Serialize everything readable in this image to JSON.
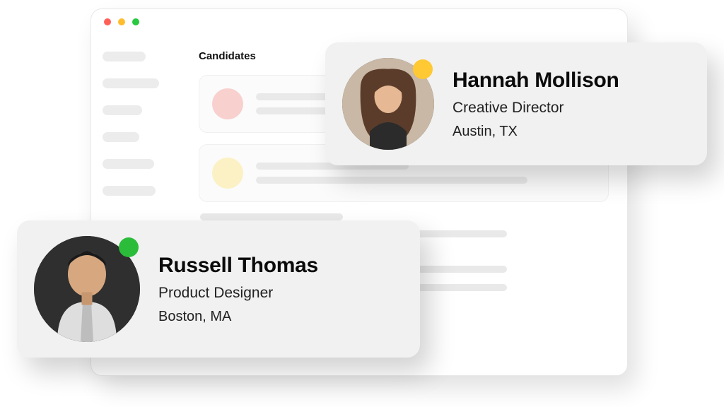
{
  "window": {
    "section_title": "Candidates"
  },
  "candidates": [
    {
      "name": "Hannah Mollison",
      "role": "Creative Director",
      "location": "Austin, TX",
      "status_color": "#ffc933"
    },
    {
      "name": "Russell Thomas",
      "role": "Product Designer",
      "location": "Boston, MA",
      "status_color": "#2bbd3a"
    }
  ]
}
